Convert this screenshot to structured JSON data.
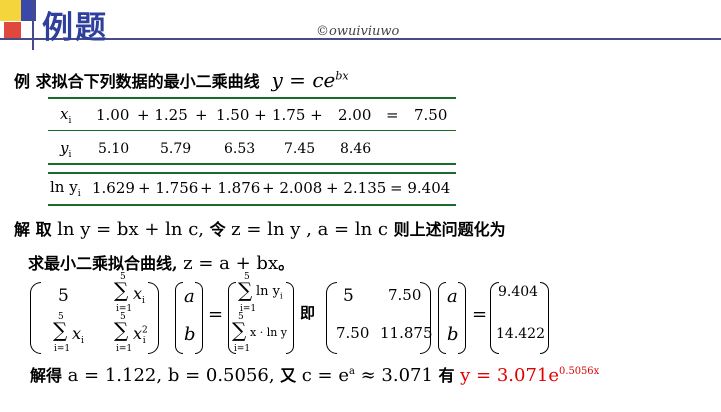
{
  "header": {
    "title": "例题",
    "watermark": "©owuiviuwo"
  },
  "problem": {
    "prefix": "例 求拟合下列数据的最小二乘曲线",
    "formula_y": "y",
    "formula_eq": " = ",
    "formula_c": "ce",
    "formula_exp": "bx"
  },
  "table": {
    "x_label": "x",
    "x_sub": "i",
    "x_values": [
      "1.00",
      "+ 1.25",
      "+",
      "1.50 +",
      "1.75 +",
      "2.00",
      "=",
      "7.50"
    ],
    "y_label": "y",
    "y_sub": "i",
    "y_values": [
      "5.10",
      "5.79",
      "6.53",
      "7.45",
      "8.46"
    ],
    "ln_label": "ln y",
    "ln_sub": "i",
    "ln_values": [
      "1.629",
      "+ 1.756",
      "+ 1.876",
      "+ 2.008",
      "+ 2.135",
      "= 9.404"
    ]
  },
  "solution": {
    "line1_a": "解 取",
    "line1_m1": "ln y = bx + ln c,",
    "line1_b": "令",
    "line1_m2": "z = ln y , a = ln c",
    "line1_c": "则上述问题化为",
    "line2_a": "求最小二乘拟合曲线,",
    "line2_m": "z = a + bx",
    "line2_end": "。"
  },
  "matrix_eq": {
    "m11": "5",
    "sum_x": "x",
    "sum_x_sub": "i",
    "sum_x2": "x",
    "sum_x2_sub": "i",
    "sum_x2_sup": "2",
    "vec_a": "a",
    "vec_b": "b",
    "rhs1": "ln y",
    "rhs1_sub": "i",
    "rhs2": "x · ln y",
    "rhs2_sub_x": "i",
    "rhs2_sub_y": "i",
    "sum_top": "5",
    "sum_bottom": "i=1",
    "ji": "即",
    "n11": "5",
    "n12": "7.50",
    "n21": "7.50",
    "n22": "11.875",
    "r1": "9.404",
    "r2": "14.422",
    "eq": "="
  },
  "final": {
    "prefix": "解得",
    "values": "a = 1.122, b = 0.5056,",
    "you": "又",
    "c_expr": "c = e",
    "c_exp": "a",
    "c_approx": " ≈ 3.071",
    "has": "有",
    "result": "y = 3.071e",
    "result_exp": "0.5056x"
  },
  "colors": {
    "title": "#2e3f9c",
    "rule": "#1a6a2a",
    "result": "#e00000"
  }
}
